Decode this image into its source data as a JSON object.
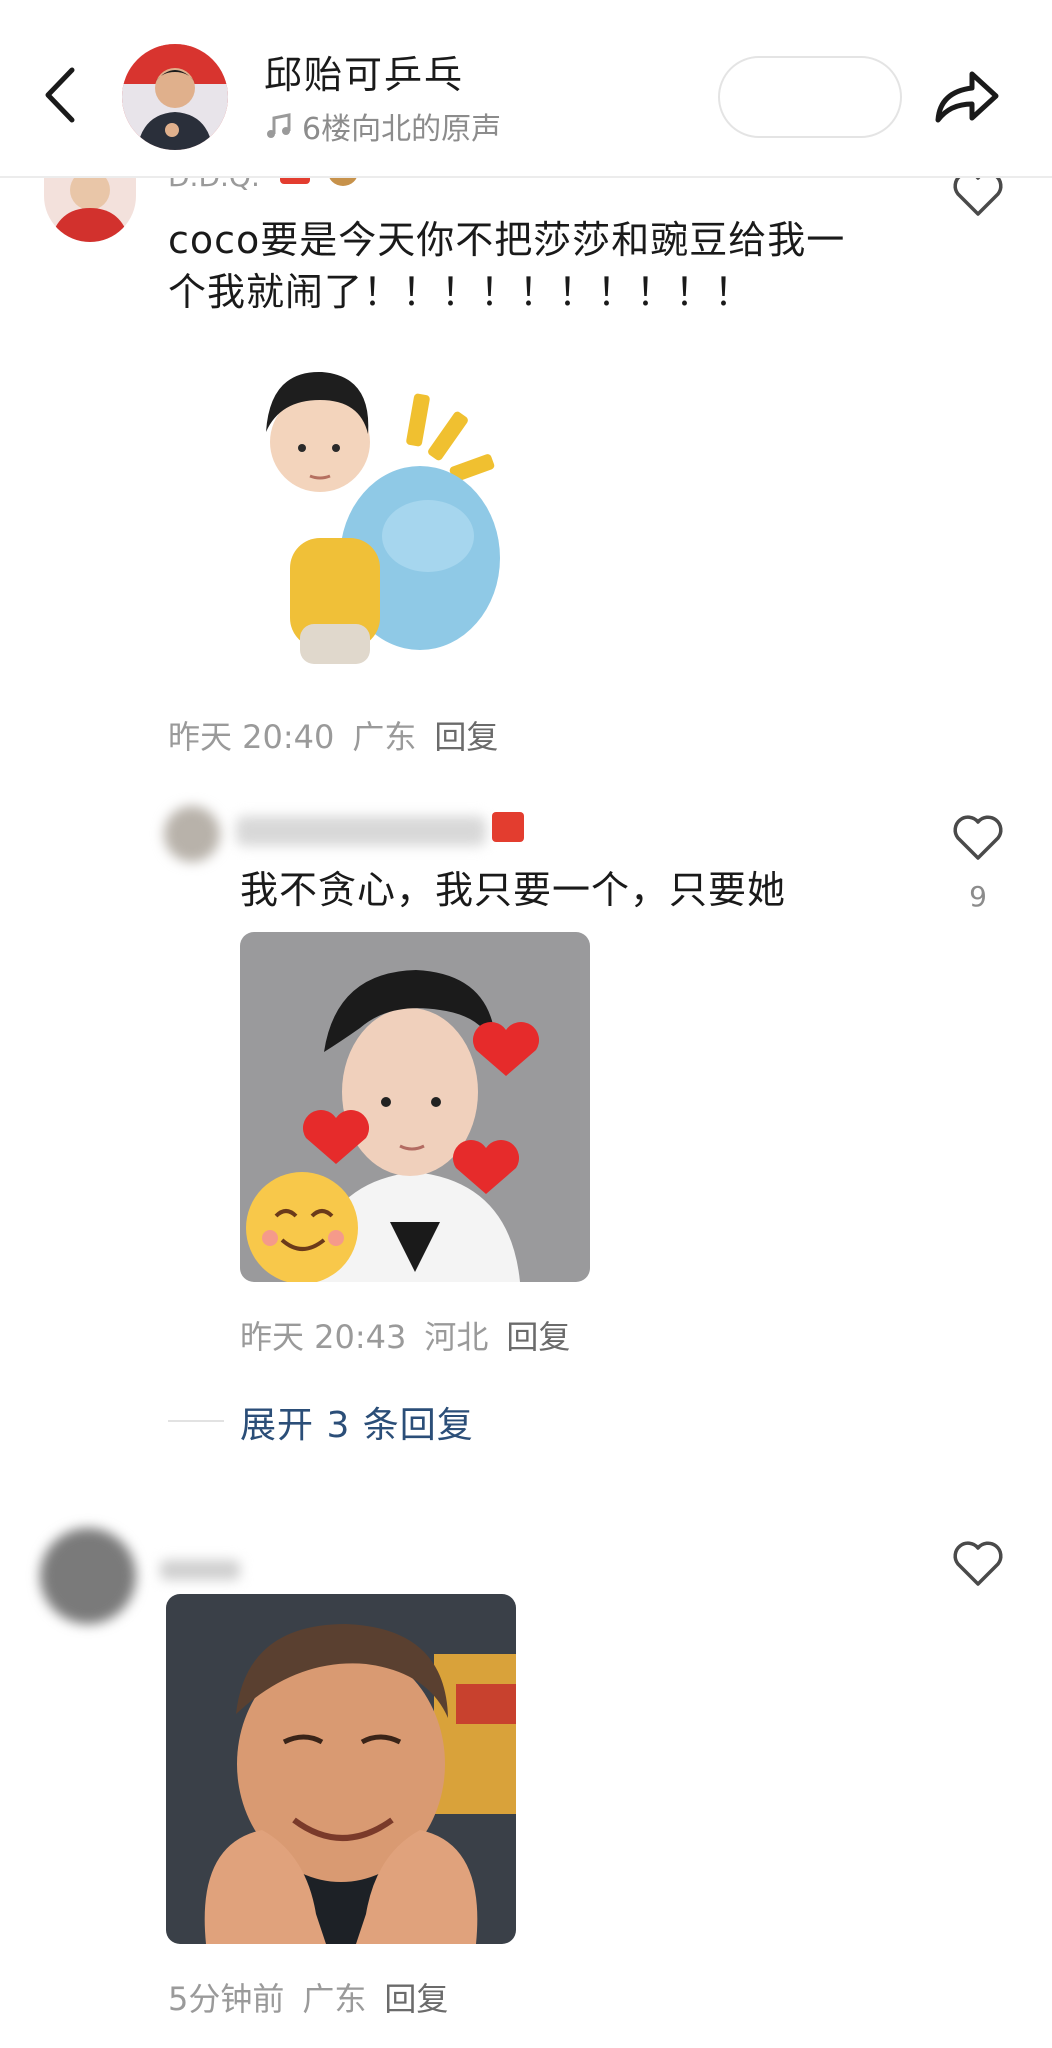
{
  "header": {
    "title": "邱贻可乒乓",
    "subtitle": "6楼向北的原声",
    "back_icon": "chevron-left-icon",
    "share_icon": "share-arrow-icon",
    "music_icon": "music-note-icon"
  },
  "comments": [
    {
      "username": "D.D.Q.",
      "text_line1": "coco要是今天你不把莎莎和豌豆给我一",
      "text_line2": "个我就闹了！！！！！！！！！！",
      "sticker": "child-with-blue-backpack-sticker",
      "time": "昨天 20:40",
      "location": "广东",
      "reply_label": "回复"
    },
    {
      "text": "我不贪心，我只要一个，只要她",
      "sticker": "girl-with-hearts-sticker",
      "time": "昨天 20:43",
      "location": "河北",
      "reply_label": "回复",
      "likes": "9"
    },
    {
      "sticker": "smiling-man-hands-on-chin-photo",
      "time": "5分钟前",
      "location": "广东",
      "reply_label": "回复"
    }
  ],
  "expand": {
    "label": "展开 3 条回复"
  },
  "colors": {
    "link": "#2b4e78",
    "muted": "#9a9a9a",
    "text": "#1a1a1a"
  }
}
